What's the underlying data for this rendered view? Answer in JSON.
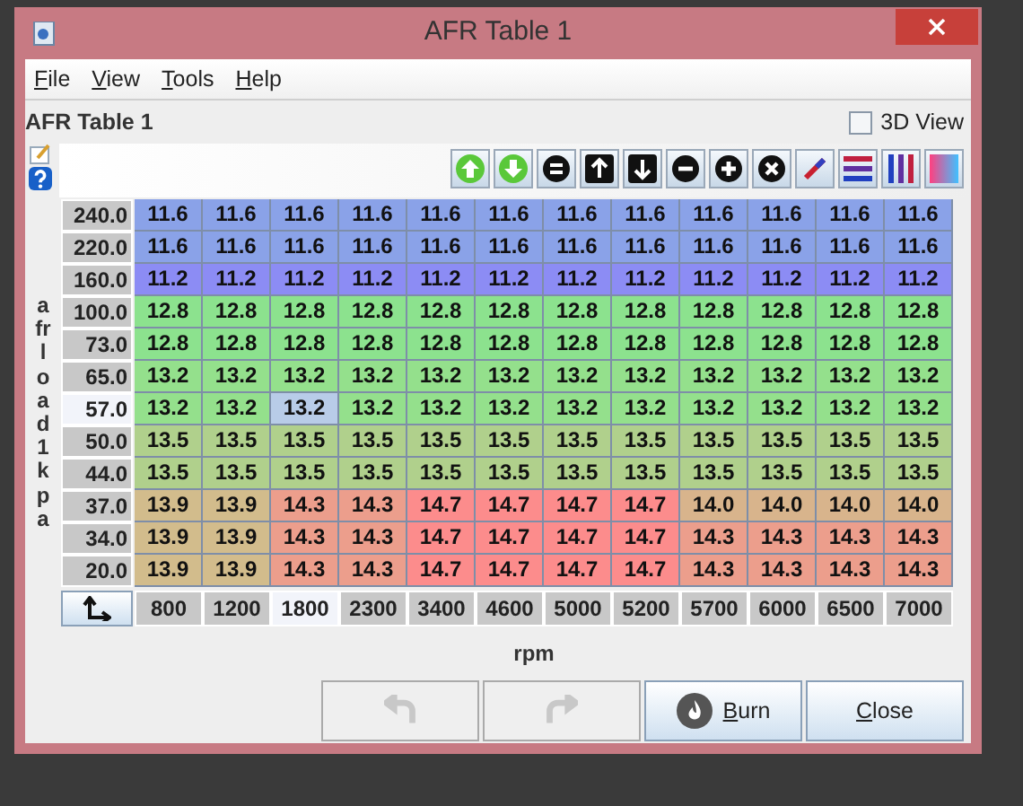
{
  "window": {
    "title": "AFR Table 1"
  },
  "menu": [
    "File",
    "View",
    "Tools",
    "Help"
  ],
  "table_title": "AFR Table 1",
  "view_3d": {
    "label": "3D View",
    "checked": false
  },
  "y_axis_label": "afrload1 kpa",
  "rows": [
    {
      "load": "240.0",
      "selected": false,
      "cells": [
        "11.6",
        "11.6",
        "11.6",
        "11.6",
        "11.6",
        "11.6",
        "11.6",
        "11.6",
        "11.6",
        "11.6",
        "11.6",
        "11.6"
      ]
    },
    {
      "load": "220.0",
      "selected": false,
      "cells": [
        "11.6",
        "11.6",
        "11.6",
        "11.6",
        "11.6",
        "11.6",
        "11.6",
        "11.6",
        "11.6",
        "11.6",
        "11.6",
        "11.6"
      ]
    },
    {
      "load": "160.0",
      "selected": false,
      "cells": [
        "11.2",
        "11.2",
        "11.2",
        "11.2",
        "11.2",
        "11.2",
        "11.2",
        "11.2",
        "11.2",
        "11.2",
        "11.2",
        "11.2"
      ]
    },
    {
      "load": "100.0",
      "selected": false,
      "cells": [
        "12.8",
        "12.8",
        "12.8",
        "12.8",
        "12.8",
        "12.8",
        "12.8",
        "12.8",
        "12.8",
        "12.8",
        "12.8",
        "12.8"
      ]
    },
    {
      "load": "73.0",
      "selected": false,
      "cells": [
        "12.8",
        "12.8",
        "12.8",
        "12.8",
        "12.8",
        "12.8",
        "12.8",
        "12.8",
        "12.8",
        "12.8",
        "12.8",
        "12.8"
      ]
    },
    {
      "load": "65.0",
      "selected": false,
      "cells": [
        "13.2",
        "13.2",
        "13.2",
        "13.2",
        "13.2",
        "13.2",
        "13.2",
        "13.2",
        "13.2",
        "13.2",
        "13.2",
        "13.2"
      ]
    },
    {
      "load": "57.0",
      "selected": true,
      "cells": [
        "13.2",
        "13.2",
        "13.2",
        "13.2",
        "13.2",
        "13.2",
        "13.2",
        "13.2",
        "13.2",
        "13.2",
        "13.2",
        "13.2"
      ]
    },
    {
      "load": "50.0",
      "selected": false,
      "cells": [
        "13.5",
        "13.5",
        "13.5",
        "13.5",
        "13.5",
        "13.5",
        "13.5",
        "13.5",
        "13.5",
        "13.5",
        "13.5",
        "13.5"
      ]
    },
    {
      "load": "44.0",
      "selected": false,
      "cells": [
        "13.5",
        "13.5",
        "13.5",
        "13.5",
        "13.5",
        "13.5",
        "13.5",
        "13.5",
        "13.5",
        "13.5",
        "13.5",
        "13.5"
      ]
    },
    {
      "load": "37.0",
      "selected": false,
      "cells": [
        "13.9",
        "13.9",
        "14.3",
        "14.3",
        "14.7",
        "14.7",
        "14.7",
        "14.7",
        "14.0",
        "14.0",
        "14.0",
        "14.0"
      ]
    },
    {
      "load": "34.0",
      "selected": false,
      "cells": [
        "13.9",
        "13.9",
        "14.3",
        "14.3",
        "14.7",
        "14.7",
        "14.7",
        "14.7",
        "14.3",
        "14.3",
        "14.3",
        "14.3"
      ]
    },
    {
      "load": "20.0",
      "selected": false,
      "cells": [
        "13.9",
        "13.9",
        "14.3",
        "14.3",
        "14.7",
        "14.7",
        "14.7",
        "14.7",
        "14.3",
        "14.3",
        "14.3",
        "14.3"
      ]
    }
  ],
  "columns": [
    {
      "rpm": "800",
      "selected": false
    },
    {
      "rpm": "1200",
      "selected": false
    },
    {
      "rpm": "1800",
      "selected": true
    },
    {
      "rpm": "2300",
      "selected": false
    },
    {
      "rpm": "3400",
      "selected": false
    },
    {
      "rpm": "4600",
      "selected": false
    },
    {
      "rpm": "5000",
      "selected": false
    },
    {
      "rpm": "5200",
      "selected": false
    },
    {
      "rpm": "5700",
      "selected": false
    },
    {
      "rpm": "6000",
      "selected": false
    },
    {
      "rpm": "6500",
      "selected": false
    },
    {
      "rpm": "7000",
      "selected": false
    }
  ],
  "x_axis_label": "rpm",
  "undo": {
    "disabled": true
  },
  "redo": {
    "disabled": true
  },
  "buttons": [
    {
      "label": "Burn",
      "kind": "burn"
    },
    {
      "label": "Close",
      "kind": "plain"
    }
  ]
}
